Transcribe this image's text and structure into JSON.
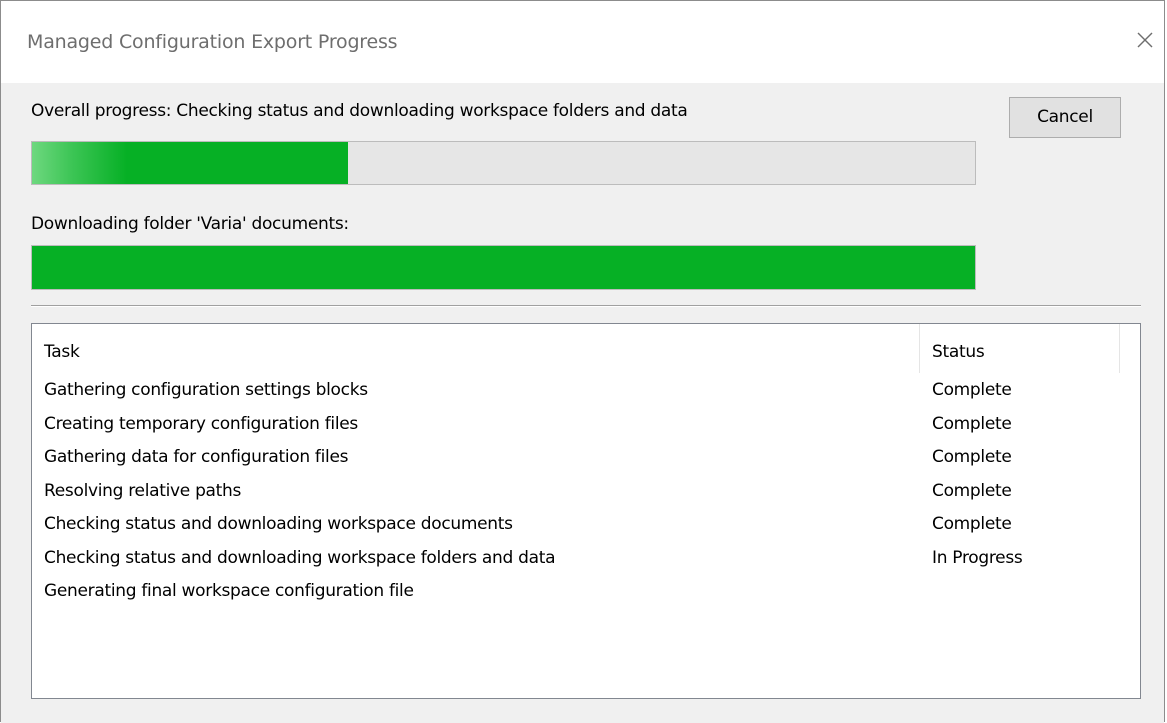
{
  "window": {
    "title": "Managed Configuration Export Progress"
  },
  "overall": {
    "label": "Overall progress: Checking status and downloading workspace folders and data",
    "progress_percent": 33.5
  },
  "folder": {
    "label": "Downloading folder 'Varia' documents:",
    "progress_percent": 100
  },
  "buttons": {
    "cancel_label": "Cancel"
  },
  "task_list": {
    "columns": {
      "task": "Task",
      "status": "Status"
    },
    "rows": [
      {
        "task": "Gathering configuration settings blocks",
        "status": "Complete"
      },
      {
        "task": "Creating temporary configuration files",
        "status": "Complete"
      },
      {
        "task": "Gathering data for configuration files",
        "status": "Complete"
      },
      {
        "task": "Resolving relative paths",
        "status": "Complete"
      },
      {
        "task": "Checking status and downloading workspace documents",
        "status": "Complete"
      },
      {
        "task": "Checking status and downloading workspace folders and data",
        "status": "In Progress"
      },
      {
        "task": "Generating final workspace configuration file",
        "status": ""
      }
    ]
  },
  "icons": {
    "close": "close-icon"
  },
  "colors": {
    "progress_green": "#06b025",
    "track_gray": "#e6e6e6"
  }
}
